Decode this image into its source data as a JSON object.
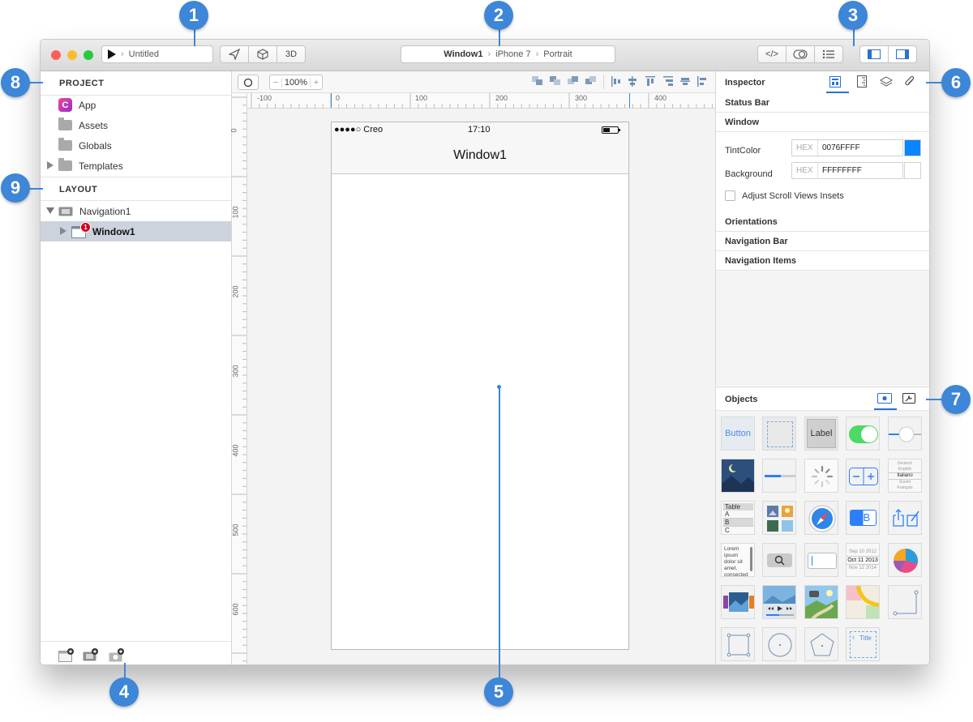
{
  "titlebar": {
    "doc_name": "Untitled",
    "breadcrumb": [
      "Window1",
      "iPhone 7",
      "Portrait"
    ],
    "btn_3d": "3D",
    "btn_code": "</>"
  },
  "sidebar": {
    "project_header": "PROJECT",
    "project_items": [
      {
        "label": "App"
      },
      {
        "label": "Assets"
      },
      {
        "label": "Globals"
      },
      {
        "label": "Templates"
      }
    ],
    "layout_header": "LAYOUT",
    "layout_items": [
      {
        "label": "Navigation1"
      },
      {
        "label": "Window1",
        "badge": "1"
      }
    ],
    "app_icon_letter": "C"
  },
  "canvas": {
    "zoom": "100%",
    "ruler_h": [
      "-100",
      "0",
      "100",
      "200",
      "300",
      "400"
    ],
    "ruler_v": [
      "0",
      "100",
      "200",
      "300",
      "400",
      "500",
      "600"
    ],
    "device": {
      "carrier": "●●●●○ Creo",
      "time": "17:10",
      "nav_title": "Window1"
    }
  },
  "inspector": {
    "title": "Inspector",
    "status_bar": "Status Bar",
    "window": "Window",
    "tint_label": "TintColor",
    "hex_label": "HEX",
    "tint_value": "0076FFFF",
    "tint_color": "#0a84ff",
    "bg_label": "Background",
    "bg_value": "FFFFFFFF",
    "adjust_label": "Adjust Scroll Views Insets",
    "orientations": "Orientations",
    "navigation_bar": "Navigation Bar",
    "navigation_items": "Navigation Items"
  },
  "objects": {
    "title": "Objects",
    "button_label": "Button",
    "label_label": "Label",
    "table_label": "Table",
    "table_rows": [
      "A",
      "B",
      "C"
    ],
    "picker_rows": [
      "Deutsch",
      "English",
      "Italiano",
      "Suomi",
      "Français"
    ],
    "textview_text": "Lorem ipsum dolor sit amet, consected",
    "dates": [
      "Sep 10 2012",
      "Oct 11 2013",
      "Nov 12 2014"
    ],
    "ab_text": "AB",
    "title_text": "Title"
  },
  "callouts": [
    "1",
    "2",
    "3",
    "4",
    "5",
    "6",
    "7",
    "8",
    "9"
  ],
  "colors": {
    "accent": "#3d86d8",
    "selection": "#ccd3dd"
  }
}
